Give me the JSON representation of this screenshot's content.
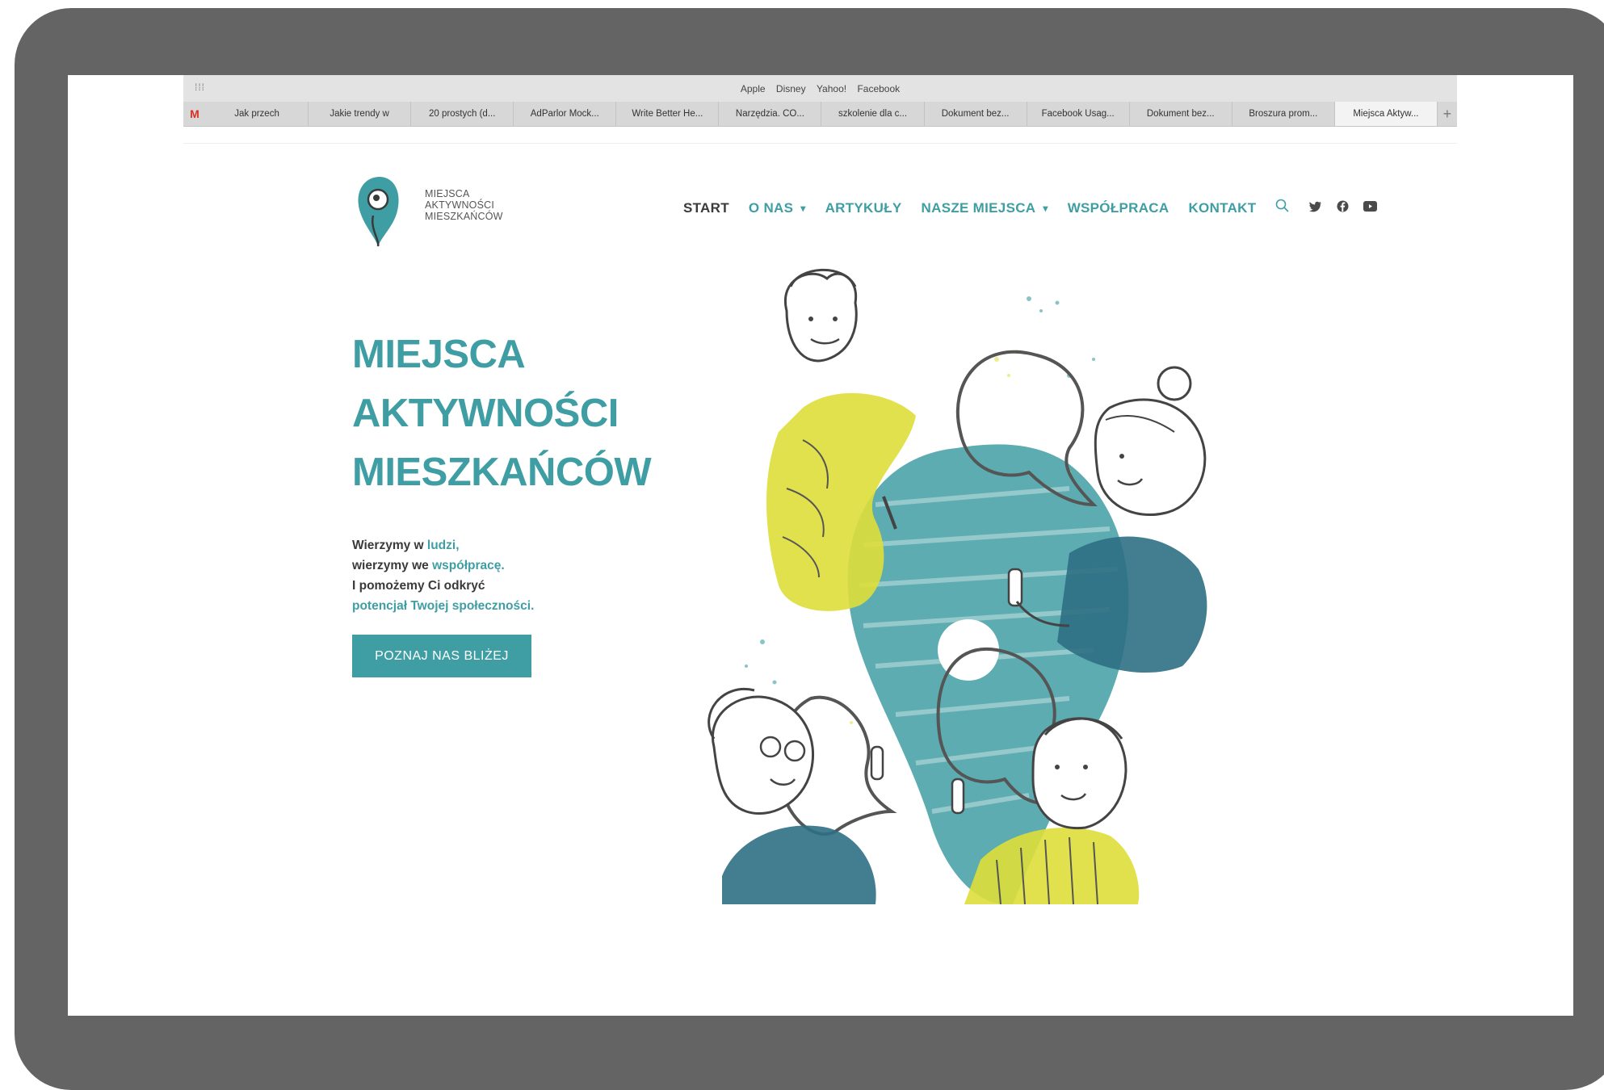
{
  "browser": {
    "apps_icon": "apps-grid-icon",
    "bookmarks": [
      "Apple",
      "Disney",
      "Yahoo!",
      "Facebook"
    ],
    "tabs": [
      "Jak przech",
      "Jakie trendy w",
      "20 prostych (d...",
      "AdParlor Mock...",
      "Write Better He...",
      "Narzędzia. CO...",
      "szkolenie dla c...",
      "Dokument bez...",
      "Facebook Usag...",
      "Dokument bez...",
      "Broszura prom...",
      "Miejsca Aktyw..."
    ],
    "active_tab": "Miejsca Aktyw...",
    "new_tab": "+",
    "gmail_glyph": "M"
  },
  "logo": {
    "line1": "MIEJSCA",
    "line2": "AKTYWNOŚCI",
    "line3": "MIESZKAŃCÓW"
  },
  "nav": {
    "start": "START",
    "o_nas": "O NAS",
    "artykuly": "ARTYKUŁY",
    "nasze_miejsca": "NASZE MIEJSCA",
    "wspolpraca": "WSPÓŁPRACA",
    "kontakt": "KONTAKT",
    "chevron": "⌄",
    "search_icon": "search-icon",
    "social": [
      "twitter-icon",
      "facebook-icon",
      "youtube-icon"
    ]
  },
  "hero": {
    "title_line1": "MIEJSCA",
    "title_line2": "AKTYWNOŚCI",
    "title_line3": "MIESZKAŃCÓW",
    "line1_a": "Wierzymy w ",
    "line1_b": "ludzi,",
    "line2_a": "wierzymy we ",
    "line2_b": "współpracę.",
    "line3": "I pomożemy Ci odkryć",
    "line4": "potencjał Twojej społeczności.",
    "cta": "POZNAJ NAS BLIŻEJ"
  },
  "colors": {
    "teal": "#3f9ea3",
    "dark_teal": "#2f6f84",
    "yellow": "#dede3a",
    "frame": "#656465"
  }
}
